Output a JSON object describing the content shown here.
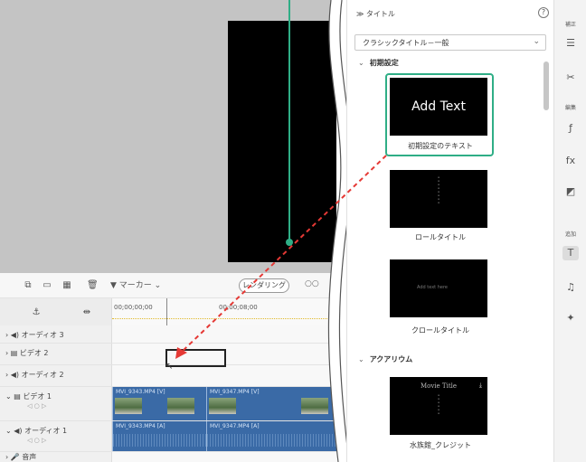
{
  "timeline": {
    "marker_label": "▼ マーカー ⌄",
    "render_label": "レンダリング",
    "zoom_label": "○○",
    "tc_start": "00;00;00;00",
    "tc_mid": "00;00;08;00",
    "tracks": [
      {
        "name": "オーディオ 3",
        "icon": "speaker-icon"
      },
      {
        "name": "ビデオ 2",
        "icon": "film-icon"
      },
      {
        "name": "オーディオ 2",
        "icon": "speaker-icon"
      },
      {
        "name": "ビデオ 1",
        "icon": "film-icon",
        "sub": "◁ ○ ▷"
      },
      {
        "name": "オーディオ 1",
        "icon": "speaker-icon",
        "sub": "◁ ○ ▷"
      },
      {
        "name": "音声",
        "icon": "mic-icon"
      }
    ],
    "clips": {
      "v1a": "MVI_9343.MP4 [V]",
      "v1b": "MVI_9347.MP4 [V]",
      "a1a": "MVI_9343.MP4 [A]",
      "a1b": "MVI_9347.MP4 [A]"
    }
  },
  "titles": {
    "panel_title": "≫ タイトル",
    "help": "?",
    "preset_value": "クラシックタイトル－一般",
    "section_basic": "初期設定",
    "section_aquarium": "アクアリウム",
    "tiles": [
      {
        "label": "初期設定のテキスト",
        "text": "Add Text"
      },
      {
        "label": "ロールタイトル",
        "text": "Add text here"
      },
      {
        "label": "クロールタイトル",
        "text": "Add text here"
      },
      {
        "label": "水族館_クレジット",
        "text": "Movie Title"
      }
    ]
  },
  "side_tools": {
    "adjust": "補正",
    "edit": "編集",
    "add": "追加"
  },
  "colors": {
    "accent_green": "#2fae86",
    "arrow_red": "#e53935",
    "clip_blue": "#3a6aa6"
  }
}
